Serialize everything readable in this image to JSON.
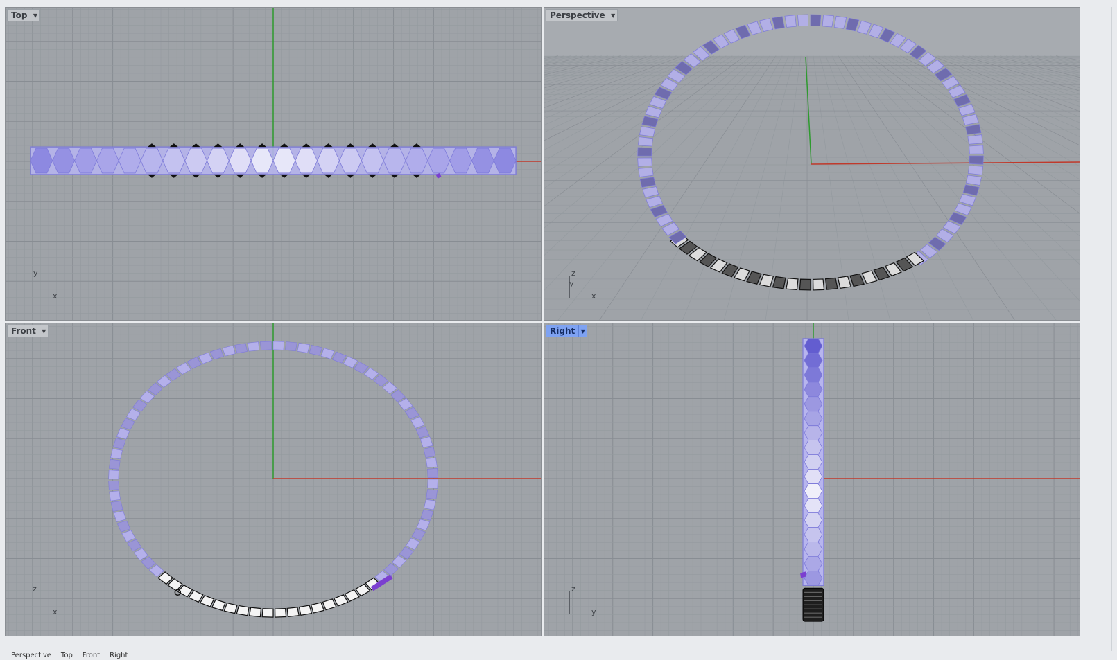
{
  "viewports": [
    {
      "id": "top",
      "label": "Top",
      "active": false,
      "axis_v": "y",
      "axis_h": "x"
    },
    {
      "id": "perspective",
      "label": "Perspective",
      "active": false,
      "axis_v": "z",
      "axis_v2": "y",
      "axis_h": "x"
    },
    {
      "id": "front",
      "label": "Front",
      "active": false,
      "axis_v": "z",
      "axis_h": "x"
    },
    {
      "id": "right",
      "label": "Right",
      "active": true,
      "axis_v": "z",
      "axis_h": "y"
    }
  ],
  "tabs": [
    "Perspective",
    "Top",
    "Front",
    "Right"
  ],
  "colors": {
    "viewport_bg": "#9fa3a8",
    "grid_minor": "#949a9f",
    "grid_major": "#888d93",
    "x_axis": "#c0392b",
    "y_axis": "#2e9a2e",
    "selection": "#b7b5ee",
    "selection_edge": "#7d7ad9",
    "active_label": "#7ea2f2",
    "unselected_geometry": "#222222"
  }
}
